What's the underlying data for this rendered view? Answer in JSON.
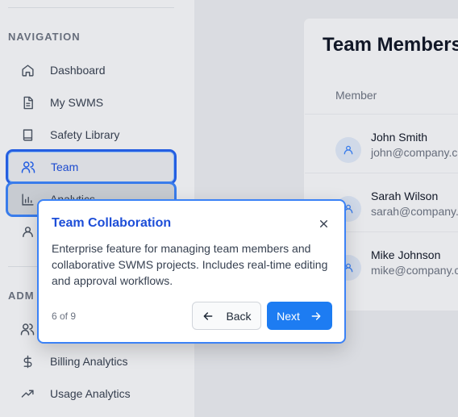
{
  "sidebar": {
    "navigation_title": "NAVIGATION",
    "admin_title": "ADM",
    "items": [
      {
        "label": "Dashboard",
        "icon": "home-icon"
      },
      {
        "label": "My SWMS",
        "icon": "document-icon"
      },
      {
        "label": "Safety Library",
        "icon": "book-icon"
      },
      {
        "label": "Team",
        "icon": "users-icon"
      },
      {
        "label": "Analytics",
        "icon": "bar-chart-icon"
      },
      {
        "label": "",
        "icon": "user-icon"
      }
    ],
    "admin_items": [
      {
        "label": "",
        "icon": "users-icon"
      },
      {
        "label": "Billing Analytics",
        "icon": "dollar-icon"
      },
      {
        "label": "Usage Analytics",
        "icon": "trending-up-icon"
      }
    ]
  },
  "main": {
    "title": "Team Members",
    "column_header": "Member",
    "members": [
      {
        "name": "John Smith",
        "email": "john@company.c"
      },
      {
        "name": "Sarah Wilson",
        "email": "sarah@company."
      },
      {
        "name": "Mike Johnson",
        "email": "mike@company.c"
      }
    ]
  },
  "tour": {
    "title": "Team Collaboration",
    "body": "Enterprise feature for managing team members and collaborative SWMS projects. Includes real-time editing and approval workflows.",
    "step": "6 of 9",
    "back_label": "Back",
    "next_label": "Next"
  },
  "colors": {
    "accent": "#1d7cf2",
    "highlight_outline": "#2563eb",
    "title_blue": "#1d4ed8"
  }
}
